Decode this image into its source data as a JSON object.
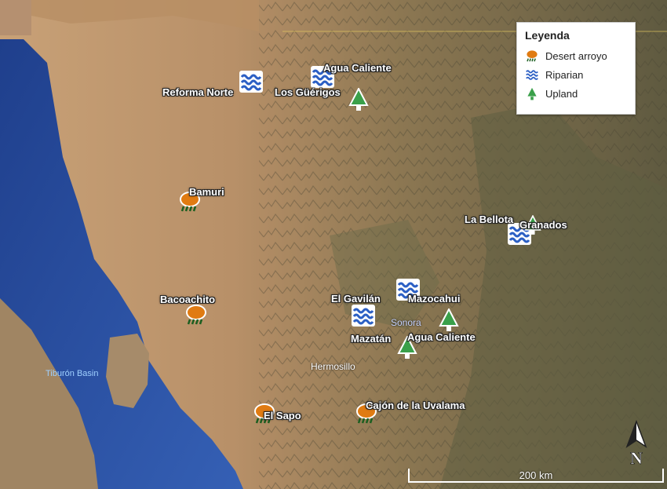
{
  "legend": {
    "title": "Leyenda",
    "items": [
      {
        "label": "Desert arroyo",
        "icon": "desert-arroyo-icon"
      },
      {
        "label": "Riparian",
        "icon": "riparian-icon"
      },
      {
        "label": "Upland",
        "icon": "upland-icon"
      }
    ]
  },
  "sites": [
    {
      "name": "Reforma Norte",
      "type": "riparian"
    },
    {
      "name": "Agua Caliente",
      "type": "riparian"
    },
    {
      "name": "Los Güérigos",
      "type": "upland"
    },
    {
      "name": "Bamuri",
      "type": "desert"
    },
    {
      "name": "La Bellota",
      "type": "riparian"
    },
    {
      "name": "Granados",
      "type": "upland"
    },
    {
      "name": "Mazocahui",
      "type": "riparian"
    },
    {
      "name": "El Gavilán",
      "type": "riparian"
    },
    {
      "name": "Mazatán",
      "type": "upland"
    },
    {
      "name": "Agua Caliente",
      "type": "upland"
    },
    {
      "name": "Bacoachito",
      "type": "desert"
    },
    {
      "name": "El Sapo",
      "type": "desert"
    },
    {
      "name": "Cajón de la Uvalama",
      "type": "desert"
    }
  ],
  "places": {
    "hermosillo": "Hermosillo",
    "sonora": "Sonora",
    "tiburon": "Tiburón Basin"
  },
  "scale": {
    "label": "200 km"
  },
  "north": {
    "label": "N"
  },
  "colors": {
    "sea": "#2f55a8",
    "desert_land": "#c49a6c",
    "mountain_land": "#6e6547",
    "desert_icon": "#e07b12",
    "riparian_icon": "#2b5fc4",
    "upland_icon": "#3aa04a"
  }
}
